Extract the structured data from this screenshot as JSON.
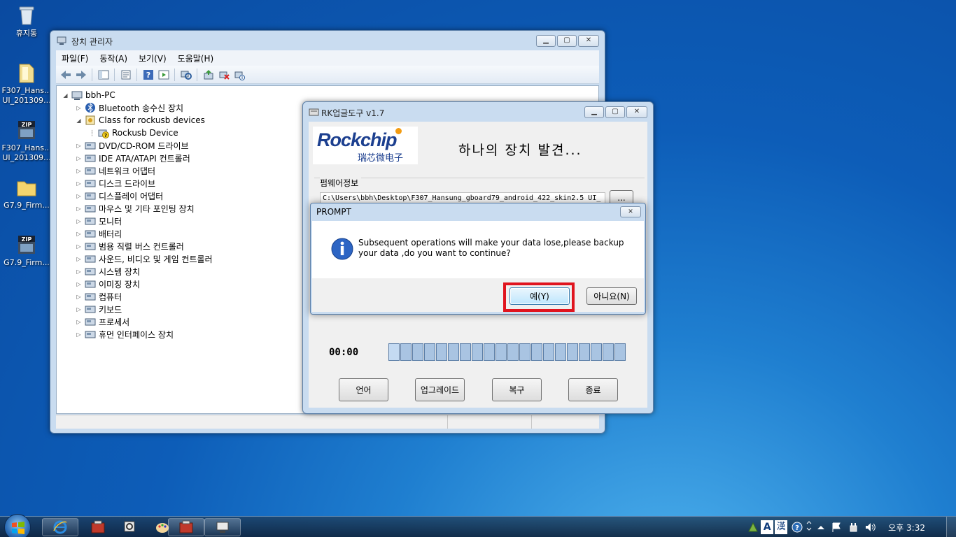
{
  "desktop": {
    "icons": [
      {
        "label": "휴지통",
        "icon": "recycle-bin-icon"
      },
      {
        "label": "F307_Hans... UI_201309...",
        "icon": "folder-icon"
      },
      {
        "label": "F307_Hans... UI_201309...",
        "icon": "zip-icon"
      },
      {
        "label": "G7.9_Firm...",
        "icon": "folder-icon"
      },
      {
        "label": "G7.9_Firm...",
        "icon": "zip-icon"
      }
    ]
  },
  "devmgr": {
    "title": "장치 관리자",
    "menu": [
      "파일(F)",
      "동작(A)",
      "보기(V)",
      "도움말(H)"
    ],
    "root": "bbh-PC",
    "tree": [
      {
        "label": "Bluetooth 송수신 장치",
        "indent": 1,
        "expanded": false,
        "icon": "bluetooth-icon"
      },
      {
        "label": "Class for rockusb devices",
        "indent": 1,
        "expanded": true,
        "icon": "usb-class-icon"
      },
      {
        "label": "Rockusb Device",
        "indent": 2,
        "expanded": null,
        "icon": "unknown-device-icon"
      },
      {
        "label": "DVD/CD-ROM 드라이브",
        "indent": 1,
        "expanded": false,
        "icon": "dvd-drive-icon"
      },
      {
        "label": "IDE ATA/ATAPI 컨트롤러",
        "indent": 1,
        "expanded": false,
        "icon": "ide-controller-icon"
      },
      {
        "label": "네트워크 어댑터",
        "indent": 1,
        "expanded": false,
        "icon": "network-adapter-icon"
      },
      {
        "label": "디스크 드라이브",
        "indent": 1,
        "expanded": false,
        "icon": "disk-drive-icon"
      },
      {
        "label": "디스플레이 어댑터",
        "indent": 1,
        "expanded": false,
        "icon": "display-adapter-icon"
      },
      {
        "label": "마우스 및 기타 포인팅 장치",
        "indent": 1,
        "expanded": false,
        "icon": "mouse-icon"
      },
      {
        "label": "모니터",
        "indent": 1,
        "expanded": false,
        "icon": "monitor-icon"
      },
      {
        "label": "배터리",
        "indent": 1,
        "expanded": false,
        "icon": "battery-icon"
      },
      {
        "label": "범용 직렬 버스 컨트롤러",
        "indent": 1,
        "expanded": false,
        "icon": "usb-controller-icon"
      },
      {
        "label": "사운드, 비디오 및 게임 컨트롤러",
        "indent": 1,
        "expanded": false,
        "icon": "sound-icon"
      },
      {
        "label": "시스템 장치",
        "indent": 1,
        "expanded": false,
        "icon": "system-device-icon"
      },
      {
        "label": "이미징 장치",
        "indent": 1,
        "expanded": false,
        "icon": "imaging-device-icon"
      },
      {
        "label": "컴퓨터",
        "indent": 1,
        "expanded": false,
        "icon": "computer-icon"
      },
      {
        "label": "키보드",
        "indent": 1,
        "expanded": false,
        "icon": "keyboard-icon"
      },
      {
        "label": "프로세서",
        "indent": 1,
        "expanded": false,
        "icon": "processor-icon"
      },
      {
        "label": "휴먼 인터페이스 장치",
        "indent": 1,
        "expanded": false,
        "icon": "hid-icon"
      }
    ]
  },
  "rk": {
    "title": "RK업글도구 v1.7",
    "logo_text": "Rockchip",
    "logo_sub": "瑞芯微电子",
    "status": "하나의 장치 발견...",
    "firmware_label": "펌웨어정보",
    "firmware_path": "C:\\Users\\bbh\\Desktop\\F307_Hansung_gboard79_android_422_skin2.5 UI_",
    "browse_label": "...",
    "timer": "00:00",
    "progress": 0,
    "buttons": {
      "language": "언어",
      "upgrade": "업그레이드",
      "restore": "복구",
      "exit": "종료"
    }
  },
  "prompt": {
    "title": "PROMPT",
    "message": "Subsequent operations will make your data lose,please backup your data ,do you want to continue?",
    "yes": "예(Y)",
    "no": "아니요(N)",
    "highlight_color": "#e0141e"
  },
  "taskbar": {
    "clock": "오후 3:32",
    "ime": [
      "A",
      "漢"
    ]
  }
}
